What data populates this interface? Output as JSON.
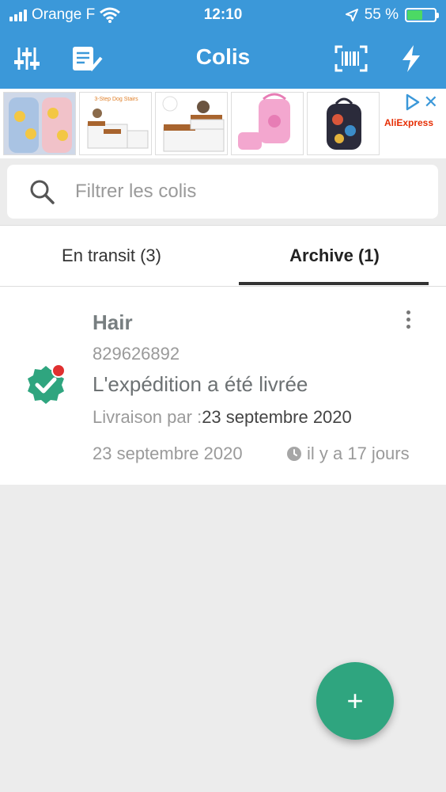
{
  "status_bar": {
    "carrier": "Orange F",
    "time": "12:10",
    "battery": "55 %",
    "battery_level": 0.55
  },
  "toolbar": {
    "title": "Colis",
    "icons": [
      "sliders-icon",
      "checklist-icon",
      "barcode-scan-icon",
      "flash-icon"
    ]
  },
  "ad": {
    "brand": "AliExpress",
    "thumbs": [
      "dog-clothes-thumb",
      "dog-stairs-thumb",
      "dog-steps-thumb",
      "pink-backpack-thumb",
      "floral-backpack-thumb"
    ],
    "thumb_caption": "3-Step Dog Stairs"
  },
  "search": {
    "placeholder": "Filtrer les colis"
  },
  "tabs": [
    {
      "label": "En transit (3)",
      "active": false
    },
    {
      "label": "Archive (1)",
      "active": true
    }
  ],
  "parcel": {
    "name": "Hair",
    "tracking": "829626892",
    "status": "L'expédition a été livrée",
    "delivery_label": "Livraison par :",
    "delivery_date": "23 septembre 2020",
    "date": "23 septembre 2020",
    "ago": "il y a 17 jours",
    "badge_color": "#2fa57f",
    "dot_color": "#e03030"
  },
  "fab": {
    "label": "+"
  },
  "colors": {
    "header": "#3b98d9",
    "accent": "#2fa57f"
  }
}
